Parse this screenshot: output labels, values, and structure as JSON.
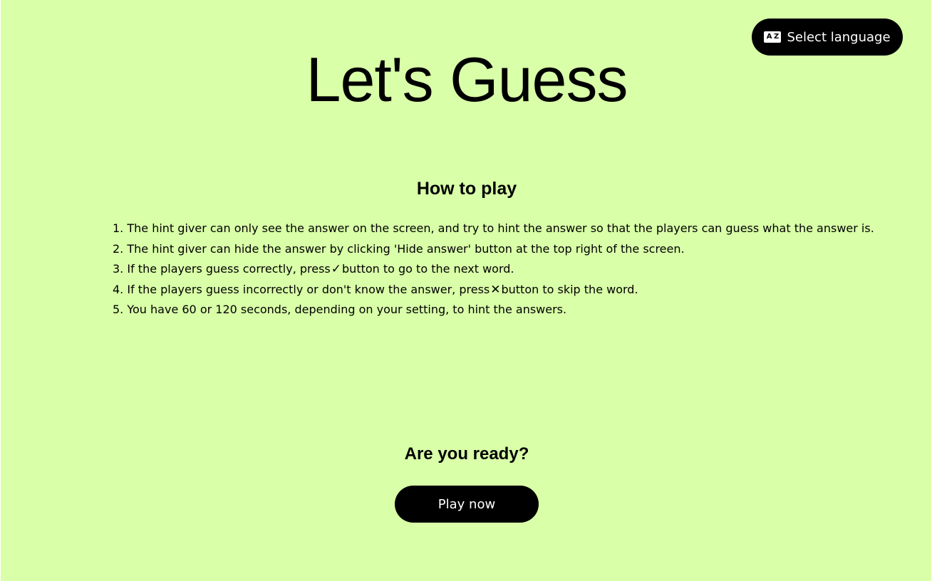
{
  "language_button": {
    "label": "Select language",
    "icon": "language-icon",
    "icon_letters": [
      "A",
      "Z"
    ]
  },
  "title": "Let's Guess",
  "how_to_play": {
    "heading": "How to play",
    "rules": [
      {
        "number": "1.",
        "text": "The hint giver can only see the answer on the screen, and try to hint the answer so that the players can guess what the answer is."
      },
      {
        "number": "2.",
        "text": "The hint giver can hide the answer by clicking 'Hide answer' button at the top right of the screen."
      },
      {
        "number": "3.",
        "before": "If the players guess correctly, press",
        "glyph": "✓",
        "glyph_icon": "check-icon",
        "after": "button to go to the next word."
      },
      {
        "number": "4.",
        "before": "If the players guess incorrectly or don't know the answer, press",
        "glyph": "✕",
        "glyph_icon": "cross-icon",
        "after": "button to skip the word."
      },
      {
        "number": "5.",
        "text": "You have 60 or 120 seconds, depending on your setting, to hint the answers."
      }
    ]
  },
  "ready": {
    "question": "Are you ready?",
    "play_button": "Play now"
  },
  "colors": {
    "background": "#d9ffa8",
    "button_bg": "#000000",
    "button_text": "#ffffff",
    "text": "#000000"
  }
}
